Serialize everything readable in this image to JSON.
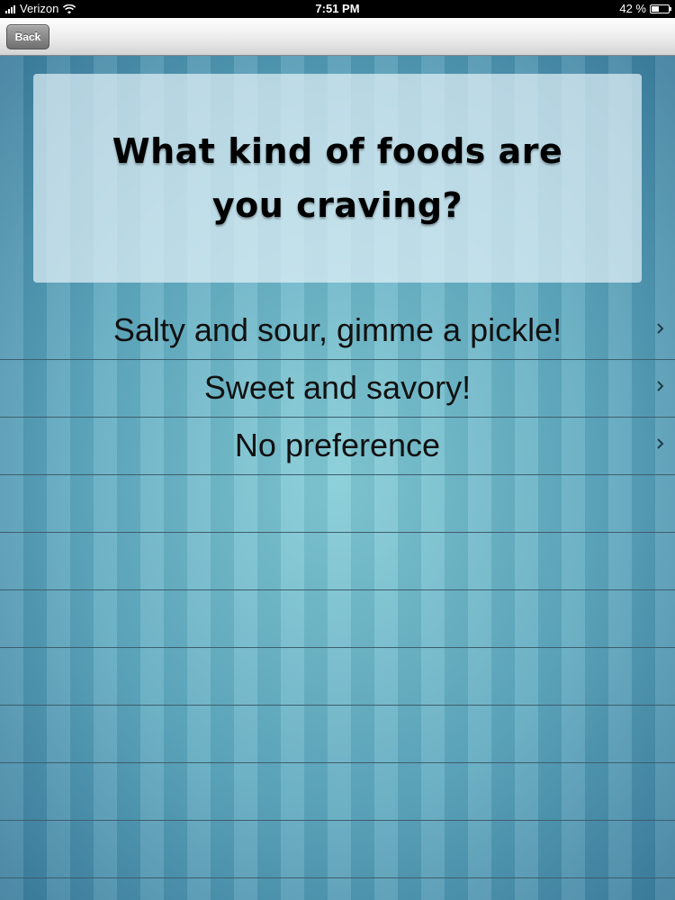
{
  "status_bar": {
    "carrier": "Verizon",
    "time": "7:51 PM",
    "battery_percent_text": "42 %",
    "battery_level": 0.42
  },
  "nav_bar": {
    "back_label": "Back"
  },
  "question": {
    "text": "What kind of foods are you craving?"
  },
  "options": [
    {
      "label": "Salty and sour, gimme a pickle!",
      "icon": "chevron-right-icon"
    },
    {
      "label": "Sweet and savory!",
      "icon": "chevron-right-icon"
    },
    {
      "label": "No preference",
      "icon": "chevron-right-icon"
    }
  ],
  "colors": {
    "background_center": "#84ccd6",
    "background_edge": "#3b7c9c",
    "card": "#e1f0f6",
    "row_separator": "#3d5e6e"
  }
}
